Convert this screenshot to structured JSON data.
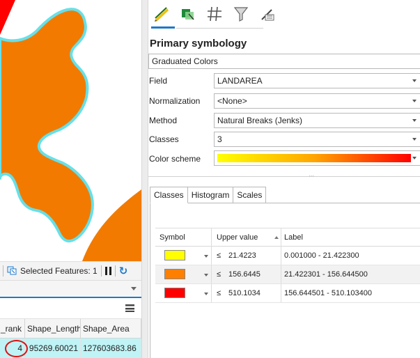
{
  "map": {
    "fill_color": "#f27a00",
    "outline_color": "#67e0e8",
    "accent_color": "#ff0000"
  },
  "status_bar": {
    "selected_features": "Selected Features: 1",
    "select_icon": "selection-icon",
    "pause_icon": "pause-icon",
    "refresh_icon": "refresh-icon"
  },
  "attribute_table": {
    "columns": [
      "_rank",
      "Shape_Length",
      "Shape_Area"
    ],
    "rows": [
      [
        "4",
        "95269.60021",
        "127603683.86"
      ]
    ],
    "highlight_color": "#bff3f5"
  },
  "symbology": {
    "toolbar_icons": [
      "primary-symbology-icon",
      "vary-symbology-icon",
      "symbol-layers-icon",
      "attribute-driven-icon",
      "symbol-properties-icon"
    ],
    "title": "Primary symbology",
    "renderer": "Graduated Colors",
    "field_label": "Field",
    "field_value": "LANDAREA",
    "normalization_label": "Normalization",
    "normalization_value": "<None>",
    "method_label": "Method",
    "method_value": "Natural Breaks (Jenks)",
    "classes_label": "Classes",
    "classes_value": "3",
    "color_scheme_label": "Color scheme",
    "color_scheme_colors": [
      "#ffff00",
      "#ffa500",
      "#ff0000"
    ],
    "tabs": [
      "Classes",
      "Histogram",
      "Scales"
    ],
    "active_tab": "Classes",
    "table": {
      "headers": [
        "Symbol",
        "Upper value",
        "Label"
      ],
      "rows": [
        {
          "color": "#ffff00",
          "op": "≤",
          "upper": "21.4223",
          "label": "0.001000 - 21.422300"
        },
        {
          "color": "#ff8000",
          "op": "≤",
          "upper": "156.6445",
          "label": "21.422301 - 156.644500"
        },
        {
          "color": "#ff0000",
          "op": "≤",
          "upper": "510.1034",
          "label": "156.644501 - 510.103400"
        }
      ]
    }
  }
}
